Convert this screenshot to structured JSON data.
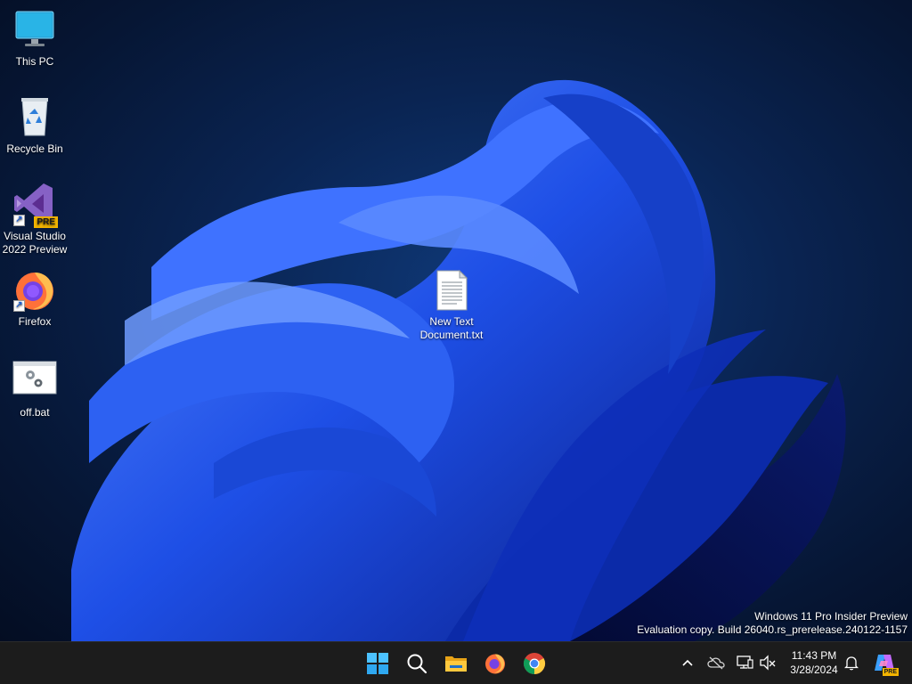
{
  "desktop": {
    "icons": [
      {
        "label": "This PC",
        "icon": "monitor-icon"
      },
      {
        "label": "Recycle Bin",
        "icon": "recycle-bin-icon"
      },
      {
        "label": "Visual Studio 2022 Preview",
        "icon": "visual-studio-icon",
        "badge": "PRE"
      },
      {
        "label": "Firefox",
        "icon": "firefox-icon"
      },
      {
        "label": "off.bat",
        "icon": "batch-file-icon"
      },
      {
        "label": "New Text Document.txt",
        "icon": "text-file-icon"
      }
    ]
  },
  "watermark": {
    "line1": "Windows 11 Pro Insider Preview",
    "line2": "Evaluation copy. Build 26040.rs_prerelease.240122-1157"
  },
  "taskbar": {
    "pinned": [
      {
        "name": "start",
        "icon": "windows-start-icon"
      },
      {
        "name": "search",
        "icon": "search-icon"
      },
      {
        "name": "file-explorer",
        "icon": "folder-icon"
      },
      {
        "name": "firefox",
        "icon": "firefox-icon"
      },
      {
        "name": "chrome",
        "icon": "chrome-icon"
      }
    ],
    "tray": [
      {
        "name": "show-hidden-icons",
        "icon": "chevron-up-icon"
      },
      {
        "name": "onedrive",
        "icon": "cloud-offline-icon"
      },
      {
        "name": "network",
        "icon": "network-icon"
      },
      {
        "name": "volume",
        "icon": "volume-muted-icon"
      }
    ],
    "clock": {
      "time": "11:43 PM",
      "date": "3/28/2024"
    },
    "copilot_badge": "PRE"
  },
  "colors": {
    "taskbar": "#1c1c1c",
    "accent_blue": "#1f5fcf",
    "vs_purple": "#8661c5",
    "pre_badge": "#f2b400"
  }
}
